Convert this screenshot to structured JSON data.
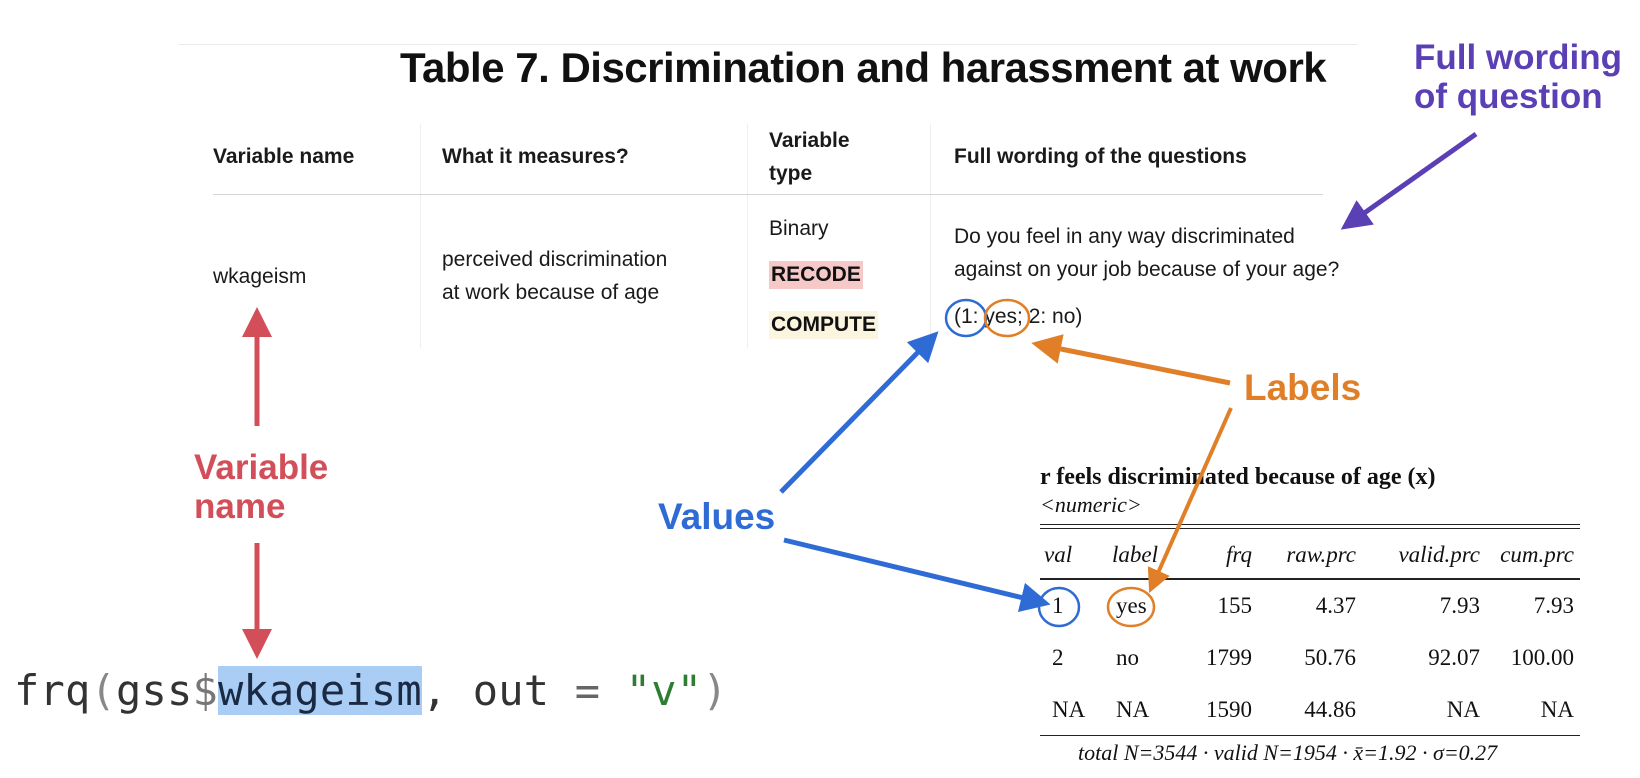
{
  "title": "Table 7. Discrimination and harassment at work",
  "annotations": {
    "full_wording": [
      "Full wording",
      "of question"
    ],
    "variable_name": [
      "Variable",
      "name"
    ],
    "values": "Values",
    "labels": "Labels"
  },
  "table": {
    "headers": {
      "variable_name": "Variable name",
      "what_measures": "What it measures?",
      "variable_type_1": "Variable",
      "variable_type_2": "type",
      "full_wording": "Full wording of the questions"
    },
    "row": {
      "variable": "wkageism",
      "measures_1": "perceived discrimination",
      "measures_2": "at work because of age",
      "type": "Binary",
      "tag_recode": "RECODE",
      "tag_compute": "COMPUTE",
      "question_1": "Do you feel in any way discriminated",
      "question_2": "against on your job because of your age?",
      "coding_open": "(1: ",
      "coding_yes": "yes;",
      "coding_rest": " 2: no)"
    }
  },
  "code": {
    "fn": "frq",
    "open": "(",
    "obj": "gss",
    "dollar": "$",
    "var": "wkageism",
    "mid": ", out ",
    "eq": "=",
    "str": "\"v\"",
    "close": ")"
  },
  "stat_table": {
    "title": "r feels discriminated because of age (x)",
    "type": "<numeric>",
    "columns": [
      "val",
      "label",
      "frq",
      "raw.prc",
      "valid.prc",
      "cum.prc"
    ],
    "rows": [
      [
        "1",
        "yes",
        "155",
        "4.37",
        "7.93",
        "7.93"
      ],
      [
        "2",
        "no",
        "1799",
        "50.76",
        "92.07",
        "100.00"
      ],
      [
        "NA",
        "NA",
        "1590",
        "44.86",
        "NA",
        "NA"
      ]
    ],
    "footer": "total N=3544 · valid N=1954 · x̄=1.92 · σ=0.27"
  },
  "colors": {
    "purple": "#5b3fb5",
    "red": "#d24f5a",
    "orange": "#e17f28",
    "blue": "#2f6bd4",
    "code_highlight": "#a9cdf4",
    "recode_bg": "#f6c8c8",
    "compute_bg": "#fbf4de"
  }
}
